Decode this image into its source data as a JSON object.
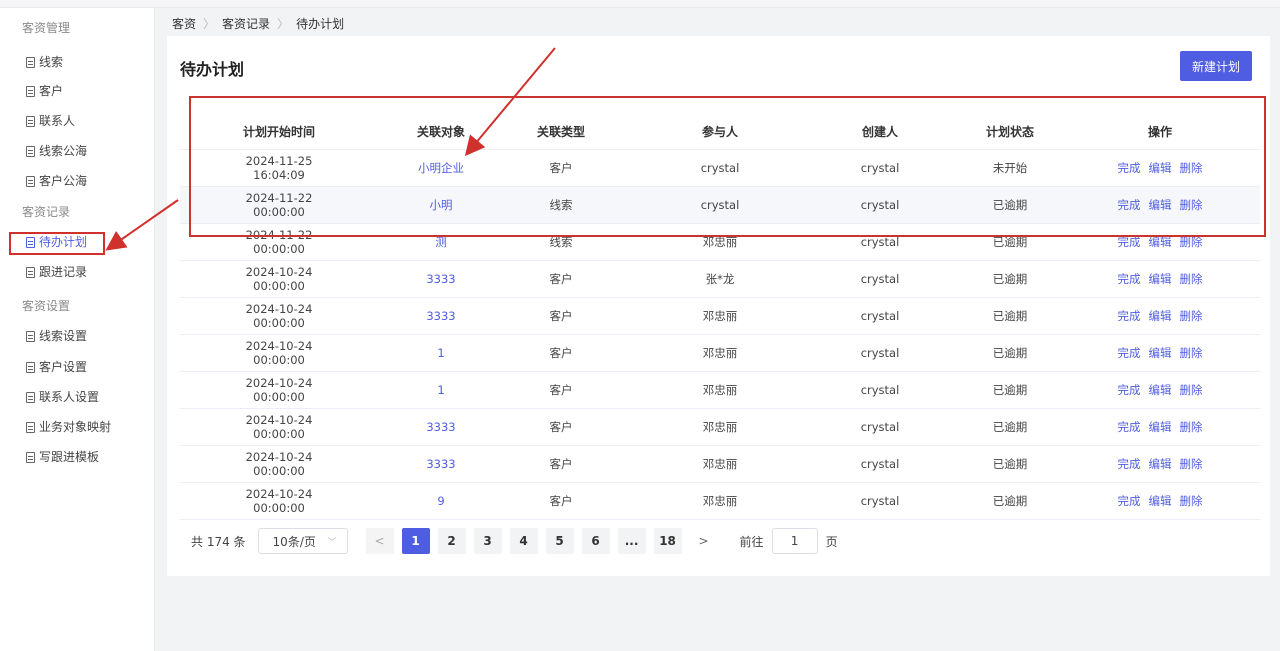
{
  "sidebar": {
    "groups": [
      {
        "title": "客资管理",
        "items": [
          "线索",
          "客户",
          "联系人",
          "线索公海",
          "客户公海"
        ]
      },
      {
        "title": "客资记录",
        "items": [
          "待办计划",
          "跟进记录"
        ]
      },
      {
        "title": "客资设置",
        "items": [
          "线索设置",
          "客户设置",
          "联系人设置",
          "业务对象映射",
          "写跟进模板"
        ]
      }
    ],
    "active_item": "待办计划"
  },
  "breadcrumb": [
    "客资",
    "客资记录",
    "待办计划"
  ],
  "page": {
    "title": "待办计划",
    "new_button": "新建计划"
  },
  "table": {
    "headers": [
      "计划开始时间",
      "关联对象",
      "关联类型",
      "参与人",
      "创建人",
      "计划状态",
      "操作"
    ],
    "rows": [
      [
        "2024-11-25 16:04:09",
        "小明企业",
        "客户",
        "crystal",
        "crystal",
        "未开始"
      ],
      [
        "2024-11-22 00:00:00",
        "小明",
        "线索",
        "crystal",
        "crystal",
        "已逾期"
      ],
      [
        "2024-11-22 00:00:00",
        "测",
        "线索",
        "邓忠丽",
        "crystal",
        "已逾期"
      ],
      [
        "2024-10-24 00:00:00",
        "3333",
        "客户",
        "张*龙",
        "crystal",
        "已逾期"
      ],
      [
        "2024-10-24 00:00:00",
        "3333",
        "客户",
        "邓忠丽",
        "crystal",
        "已逾期"
      ],
      [
        "2024-10-24 00:00:00",
        "1",
        "客户",
        "邓忠丽",
        "crystal",
        "已逾期"
      ],
      [
        "2024-10-24 00:00:00",
        "1",
        "客户",
        "邓忠丽",
        "crystal",
        "已逾期"
      ],
      [
        "2024-10-24 00:00:00",
        "3333",
        "客户",
        "邓忠丽",
        "crystal",
        "已逾期"
      ],
      [
        "2024-10-24 00:00:00",
        "3333",
        "客户",
        "邓忠丽",
        "crystal",
        "已逾期"
      ],
      [
        "2024-10-24 00:00:00",
        "9",
        "客户",
        "邓忠丽",
        "crystal",
        "已逾期"
      ]
    ],
    "actions": [
      "完成",
      "编辑",
      "删除"
    ]
  },
  "pagination": {
    "total_text": "共 174 条",
    "page_size": "10条/页",
    "pages": [
      "1",
      "2",
      "3",
      "4",
      "5",
      "6",
      "...",
      "18"
    ],
    "current": "1",
    "goto_label": "前往",
    "goto_value": "1",
    "goto_suffix": "页"
  },
  "colors": {
    "accent": "#4f5de2",
    "annotation": "#d0312d"
  }
}
